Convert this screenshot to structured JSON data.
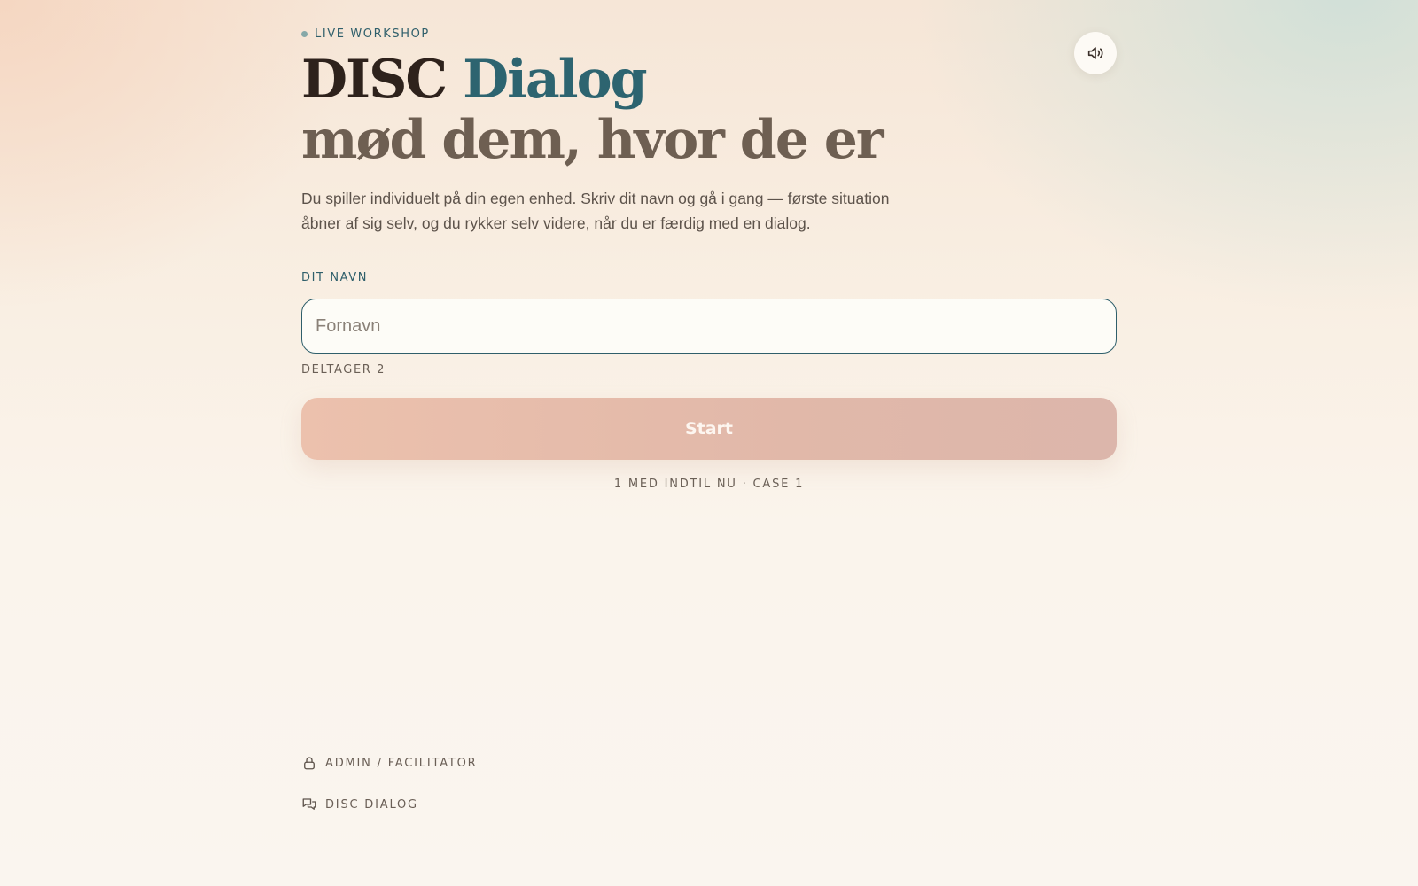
{
  "header": {
    "eyebrow": "LIVE WORKSHOP",
    "title_main": "DISC",
    "title_accent": "Dialog",
    "title_line2": "mød dem, hvor de er",
    "sound_icon": "speaker-icon"
  },
  "intro": "Du spiller individuelt på din egen enhed. Skriv dit navn og gå i gang — første situation åbner af sig selv, og du rykker selv videre, når du er færdig med en dialog.",
  "form": {
    "label": "DIT NAVN",
    "placeholder": "Fornavn",
    "value": "",
    "participant": "DELTAGER 2",
    "start_label": "Start"
  },
  "status": "1 MED INDTIL NU · CASE 1",
  "footer": {
    "admin_label": "ADMIN / FACILITATOR",
    "admin_icon": "lock-icon",
    "disc_label": "DISC DIALOG",
    "disc_icon": "chat-bubbles-icon"
  },
  "colors": {
    "accent": "#2d6470",
    "title": "#2e221c",
    "subtitle": "#6e5f52",
    "button": "#e6bdac"
  }
}
